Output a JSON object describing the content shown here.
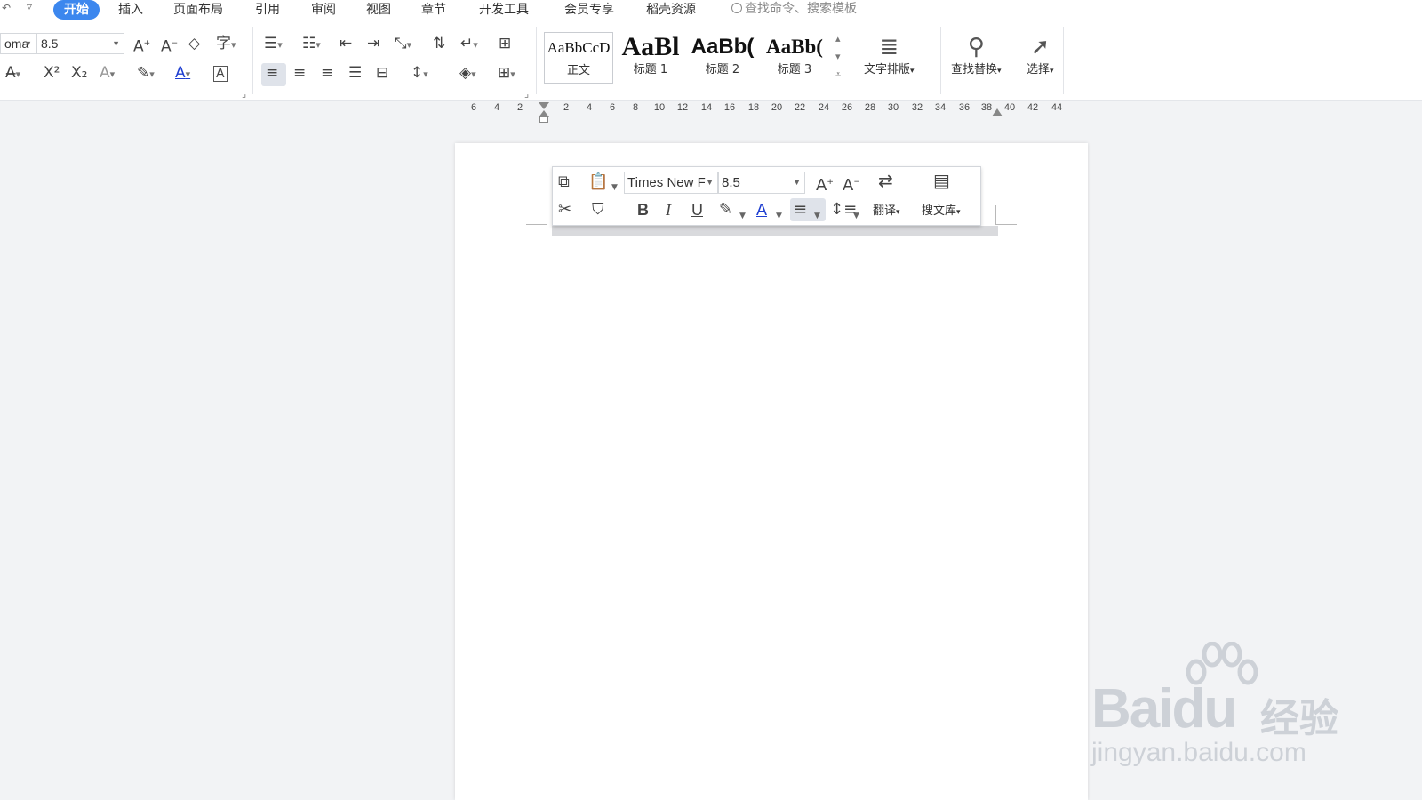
{
  "menubar": {
    "undo_icon": "undo-icon",
    "quick_access_icon": "chevron-down-icon",
    "tabs": [
      {
        "label": "开始",
        "active": true
      },
      {
        "label": "插入"
      },
      {
        "label": "页面布局"
      },
      {
        "label": "引用"
      },
      {
        "label": "审阅"
      },
      {
        "label": "视图"
      },
      {
        "label": "章节"
      },
      {
        "label": "开发工具"
      },
      {
        "label": "会员专享"
      },
      {
        "label": "稻壳资源"
      }
    ],
    "search_placeholder": "查找命令、搜索模板",
    "accent_color": "#3c87ee"
  },
  "ribbon": {
    "font_name": "oma",
    "font_size": "8.5",
    "styles": [
      {
        "sample": "AaBbCcD",
        "label": "正文"
      },
      {
        "sample": "AaBl",
        "label": "标题 1"
      },
      {
        "sample": "AaBb(",
        "label": "标题 2"
      },
      {
        "sample": "AaBb(",
        "label": "标题 3"
      }
    ],
    "text_layout_label": "文字排版",
    "find_replace_label": "查找替换",
    "select_label": "选择"
  },
  "ruler": {
    "left_ticks": [
      "6",
      "4",
      "2"
    ],
    "right_ticks": [
      "2",
      "4",
      "6",
      "8",
      "10",
      "12",
      "14",
      "16",
      "18",
      "20",
      "22",
      "24",
      "26",
      "28",
      "30",
      "32",
      "34",
      "36",
      "38",
      "40",
      "42",
      "44"
    ]
  },
  "mini_toolbar": {
    "font_name": "Times New F",
    "font_size": "8.5",
    "translate_label": "翻译",
    "search_lib_label": "搜文库"
  },
  "watermark": {
    "brand": "Bai",
    "brand_tail": "du",
    "cn": "经验",
    "url": "jingyan.baidu.com"
  }
}
